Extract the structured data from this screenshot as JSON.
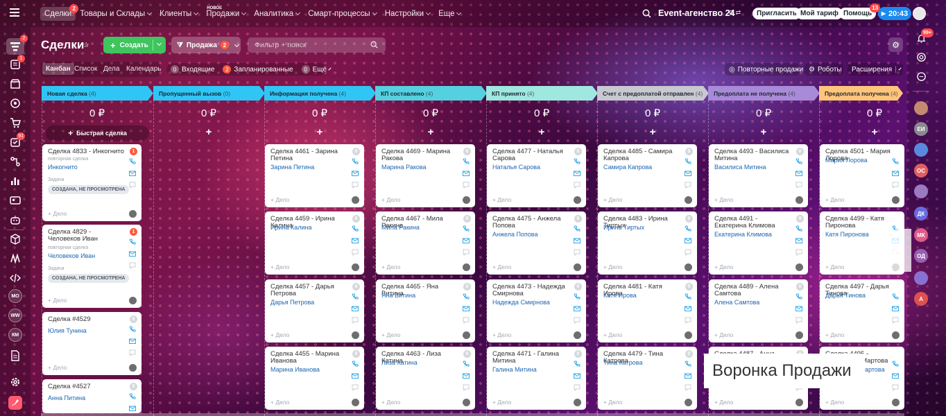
{
  "colors": {
    "accent_green": "#3fc45e",
    "badge_red": "#ff4b4b",
    "link_blue": "#2067b0",
    "clock_blue": "#1b8af1"
  },
  "topnav": {
    "items": [
      {
        "label": "Сделки",
        "badge": "2"
      },
      {
        "label": "Товары и Склады"
      },
      {
        "label": "Клиенты"
      },
      {
        "label": "Продажи",
        "tag": "НОВОЕ"
      },
      {
        "label": "Аналитика"
      },
      {
        "label": "Смарт-процессы"
      },
      {
        "label": "Настройки"
      },
      {
        "label": "Еще"
      }
    ]
  },
  "top_right": {
    "company": "Event-агенство 24",
    "invite": "Пригласить",
    "tariff": "Мой тариф",
    "help": "Помощь",
    "help_badge": "13",
    "clock": "20:43"
  },
  "left_sidebar": {
    "badges": {
      "deals": "2",
      "tasks": "1",
      "inbox": "91"
    },
    "avatars": [
      "МО",
      "WW",
      "КМ"
    ]
  },
  "right_sidebar": {
    "notify_badge": "99+",
    "avatars": [
      "ЕИ",
      "ОС",
      "ДК",
      "МК",
      "ОД",
      "А"
    ]
  },
  "header": {
    "title": "Сделки",
    "create": "Создать",
    "funnel": "Продажа",
    "funnel_count": "2",
    "search_placeholder": "Фильтр + поиск"
  },
  "views": {
    "tabs": [
      "Канбан",
      "Список",
      "Дела",
      "Календарь"
    ],
    "incoming_count": "0",
    "incoming": "Входящие",
    "planned_count": "2",
    "planned": "Запланированные",
    "more_count": "0",
    "more": "Ещё"
  },
  "toolbar_right": {
    "repeat": "Повторные продажи",
    "robots": "Роботы",
    "extensions": "Расширения"
  },
  "quick_deal": "Быстрая сделка",
  "delo_label": "+ Дело",
  "columns": [
    {
      "name": "Новая сделка",
      "count": "(4)",
      "sum": "0 ₽",
      "color": "#2fc6f6"
    },
    {
      "name": "Пропущенный вызов",
      "count": "(0)",
      "sum": "0 ₽",
      "color": "#2fc6f6"
    },
    {
      "name": "Информация получена",
      "count": "(4)",
      "sum": "0 ₽",
      "color": "#2fc6f6"
    },
    {
      "name": "КП составлено",
      "count": "(4)",
      "sum": "0 ₽",
      "color": "#55d0e0"
    },
    {
      "name": "КП принято",
      "count": "(4)",
      "sum": "0 ₽",
      "color": "#9ee8e0"
    },
    {
      "name": "Счет с предоплатой отправлен",
      "count": "(4)",
      "sum": "0 ₽",
      "color": "#c8c8d0"
    },
    {
      "name": "Предоплата не получена",
      "count": "(4)",
      "sum": "0 ₽",
      "color": "#a88ad8"
    },
    {
      "name": "Предоплата получена",
      "count": "(4)",
      "sum": "0 ₽",
      "color": "#ffc57a"
    }
  ],
  "cards": {
    "c0": [
      {
        "title": "Сделка 4833 - Инкогнито",
        "sub": "повторная сделка",
        "client": "Инкогнито",
        "task_label": "Задача",
        "task": "СОЗДАНА, НЕ ПРОСМОТРЕНА",
        "badge": "1"
      },
      {
        "title": "Сделка 4829 - Человеков Иван",
        "sub": "повторная сделка",
        "client": "Человеков Иван",
        "task_label": "Задача",
        "task": "СОЗДАНА, НЕ ПРОСМОТРЕНА",
        "badge": "1"
      },
      {
        "title": "Сделка #4529",
        "client": "Юлия Тунина",
        "badge": "0"
      },
      {
        "title": "Сделка #4527",
        "client": "Анна Питина",
        "badge": "0"
      }
    ],
    "c2": [
      {
        "title": "Сделка 4461 - Зарина Петина",
        "client": "Зарина Петина",
        "badge": "0"
      },
      {
        "title": "Сделка 4459 - Ирина Калина",
        "client": "Ирина Калина",
        "badge": "0"
      },
      {
        "title": "Сделка 4457 - Дарья Петрова",
        "client": "Дарья Петрова",
        "badge": "0"
      },
      {
        "title": "Сделка 4455 - Марина Иванова",
        "client": "Марина Иванова",
        "badge": "0"
      }
    ],
    "c3": [
      {
        "title": "Сделка 4469 - Марина Ракова",
        "client": "Марина Ракова",
        "badge": "0"
      },
      {
        "title": "Сделка 4467 - Мила Ракина",
        "client": "Мила Ракина",
        "badge": "0"
      },
      {
        "title": "Сделка 4465 - Яна Витина",
        "client": "Яна Витина",
        "badge": "0"
      },
      {
        "title": "Сделка 4463 - Лиза Катина",
        "client": "Лиза Катина",
        "badge": "0"
      }
    ],
    "c4": [
      {
        "title": "Сделка 4477 - Наталья Сарова",
        "client": "Наталья Сарова",
        "badge": "0"
      },
      {
        "title": "Сделка 4475 - Анжела Попова",
        "client": "Анжела Попова",
        "badge": "0"
      },
      {
        "title": "Сделка 4473 - Надежда Смирнова",
        "client": "Надежда Смирнова",
        "badge": "0"
      },
      {
        "title": "Сделка 4471 - Галина Митина",
        "client": "Галина Митина",
        "badge": "0"
      }
    ],
    "c5": [
      {
        "title": "Сделка 4485 - Самира Капрова",
        "client": "Самира Капрова",
        "badge": "0"
      },
      {
        "title": "Сделка 4483 - Ирина Тиртых",
        "client": "Ирина Тиртых",
        "badge": "0"
      },
      {
        "title": "Сделка 4481 - Катя Ирова",
        "client": "Катя Ирова",
        "badge": "0"
      },
      {
        "title": "Сделка 4479 - Тина Катрова",
        "client": "Тина Катрова",
        "badge": "0"
      }
    ],
    "c6": [
      {
        "title": "Сделка 4493 - Василиса Митина",
        "client": "Василиса Митина",
        "badge": "0"
      },
      {
        "title": "Сделка 4491 - Екатерина Климова",
        "client": "Екатерина Климова",
        "badge": "0"
      },
      {
        "title": "Сделка 4489 - Алена Самтова",
        "client": "Алена Самтова",
        "badge": "0"
      },
      {
        "title": "Сделка 4487 - Анна Павлова",
        "client": "",
        "badge": "0"
      }
    ],
    "c7": [
      {
        "title": "Сделка 4501 - Мария Лорова",
        "client": "Мария Лорова",
        "badge": ""
      },
      {
        "title": "Сделка 4499 - Катя Пиронова",
        "client": "Катя Пиронова",
        "badge": ""
      },
      {
        "title": "Сделка 4497 - Дарья Тинова",
        "client": "Дарья Тинова",
        "badge": ""
      },
      {
        "title": "Сделка 4495 - Мирослава Мартова",
        "client": "Мирослава Мартова",
        "badge": ""
      }
    ]
  },
  "overlay_caption": "Воронка Продажи"
}
